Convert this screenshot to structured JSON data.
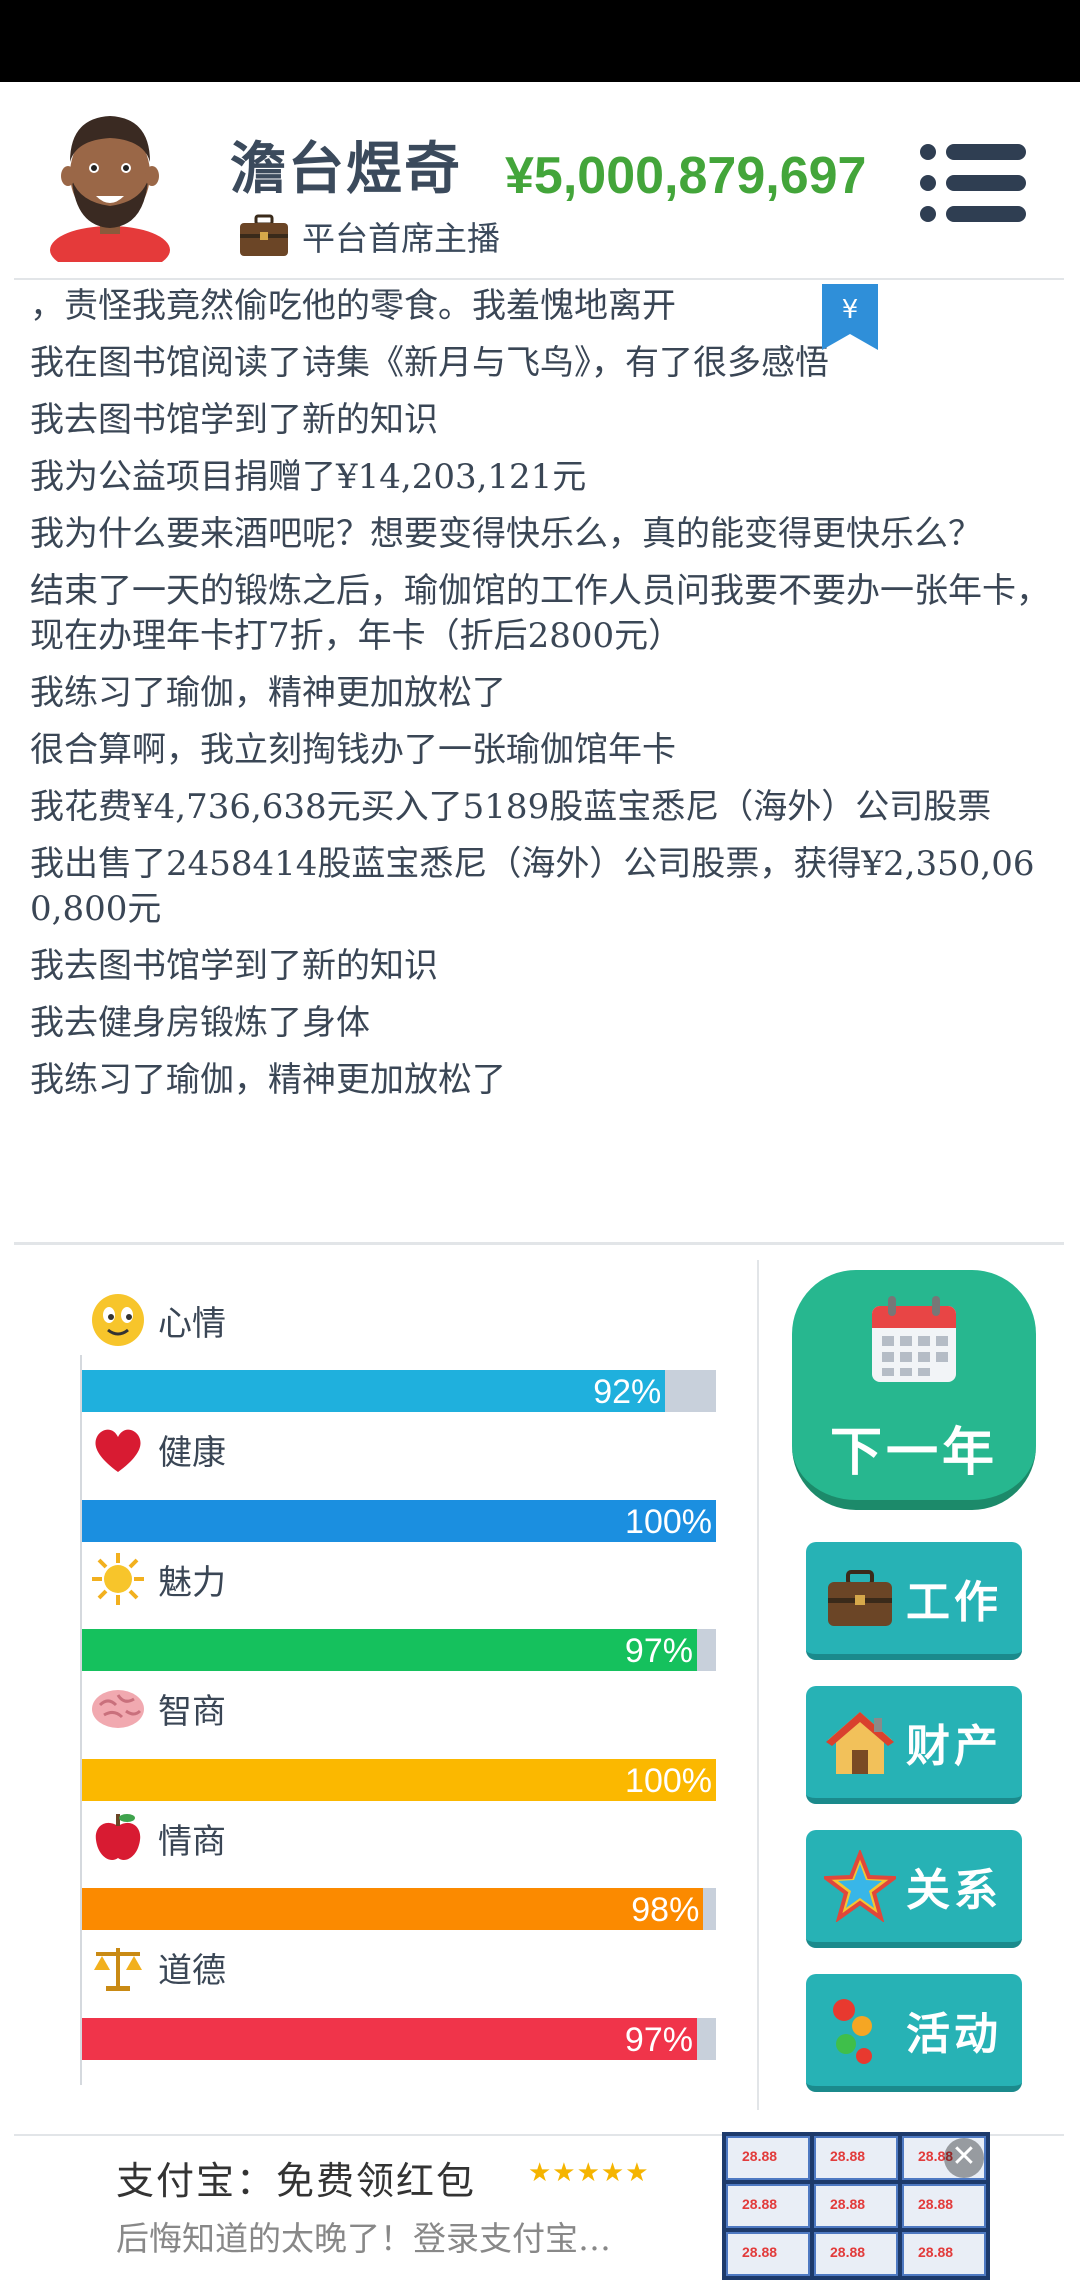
{
  "header": {
    "name": "澹台煜奇",
    "money": "¥5,000,879,697",
    "job_title": "平台首席主播"
  },
  "log": [
    "，责怪我竟然偷吃他的零食。我羞愧地离开",
    "我在图书馆阅读了诗集《新月与飞鸟》，有了很多感悟",
    "我去图书馆学到了新的知识",
    "我为公益项目捐赠了¥14,203,121元",
    "我为什么要来酒吧呢？想要变得快乐么，真的能变得更快乐么？",
    "结束了一天的锻炼之后，瑜伽馆的工作人员问我要不要办一张年卡，现在办理年卡打7折，年卡（折后2800元）",
    "我练习了瑜伽，精神更加放松了",
    "很合算啊，我立刻掏钱办了一张瑜伽馆年卡",
    "我花费¥4,736,638元买入了5189股蓝宝悉尼（海外）公司股票",
    "我出售了2458414股蓝宝悉尼（海外）公司股票，获得¥2,350,060,800元",
    "我去图书馆学到了新的知识",
    "我去健身房锻炼了身体",
    "我练习了瑜伽，精神更加放松了"
  ],
  "stats": [
    {
      "label": "心情",
      "value": 92,
      "text": "92%",
      "color": "#1fb0dd",
      "icon": "smiley-icon"
    },
    {
      "label": "健康",
      "value": 100,
      "text": "100%",
      "color": "#1b8fe0",
      "icon": "heart-icon"
    },
    {
      "label": "魅力",
      "value": 97,
      "text": "97%",
      "color": "#15c15d",
      "icon": "sun-icon"
    },
    {
      "label": "智商",
      "value": 100,
      "text": "100%",
      "color": "#fbb800",
      "icon": "brain-icon"
    },
    {
      "label": "情商",
      "value": 98,
      "text": "98%",
      "color": "#fb8a00",
      "icon": "apple-icon"
    },
    {
      "label": "道德",
      "value": 97,
      "text": "97%",
      "color": "#f0344a",
      "icon": "scales-icon"
    }
  ],
  "buttons": {
    "next_year": "下一年",
    "work": "工作",
    "property": "财产",
    "relations": "关系",
    "activities": "活动"
  },
  "ad": {
    "title": "支付宝：免费领红包",
    "stars": "★★★★★",
    "desc": "后悔知道的太晚了！登录支付宝…",
    "thumb_amount": "28.88"
  },
  "colors": {
    "money": "#43a53a",
    "next_year_bg": "#27b78f",
    "side_button_bg": "#27b2b5",
    "bar_track": "#c8d0db"
  }
}
